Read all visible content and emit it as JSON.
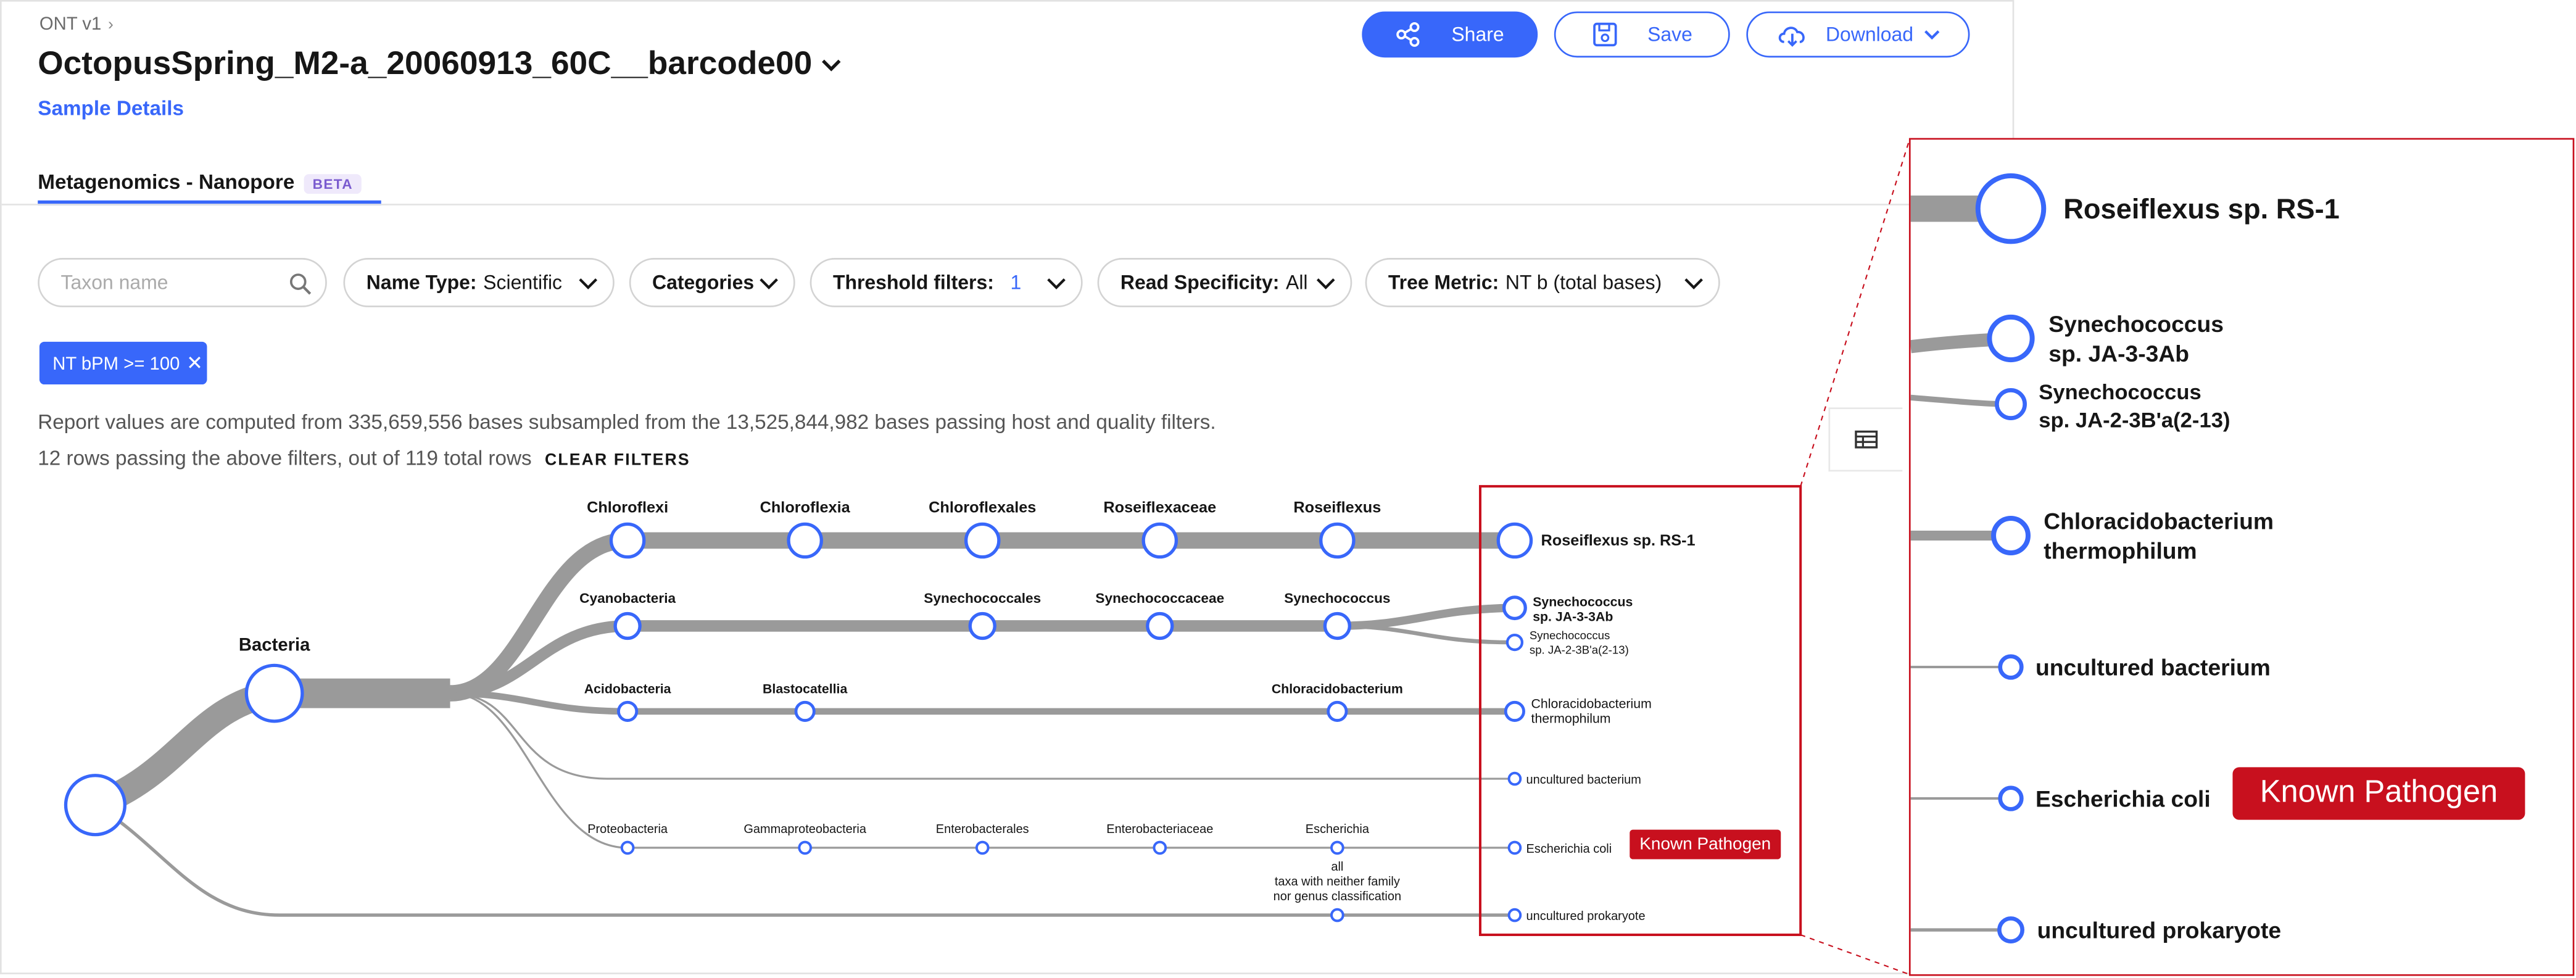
{
  "breadcrumb": {
    "project": "ONT v1",
    "separator": "›"
  },
  "sample": {
    "name": "OctopusSpring_M2-a_20060913_60C__barcode00",
    "details_link": "Sample Details"
  },
  "header_buttons": {
    "share": "Share",
    "save": "Save",
    "download": "Download"
  },
  "tab": {
    "label": "Metagenomics - Nanopore",
    "badge": "BETA"
  },
  "filters": {
    "search_placeholder": "Taxon name",
    "name_type": {
      "label": "Name Type:",
      "value": "Scientific"
    },
    "categories": {
      "label": "Categories"
    },
    "threshold": {
      "label": "Threshold filters:",
      "value": "1"
    },
    "read_specificity": {
      "label": "Read Specificity:",
      "value": "All"
    },
    "tree_metric": {
      "label": "Tree Metric:",
      "value": "NT b (total bases)"
    }
  },
  "active_filter": {
    "label": "NT bPM >= 100",
    "remove": "✕"
  },
  "report_text": "Report values are computed from 335,659,556 bases subsampled from the 13,525,844,982 bases passing host and quality filters.",
  "rows_text": "12 rows passing the above filters, out of 119 total rows",
  "clear_filters": "CLEAR FILTERS",
  "colors": {
    "accent": "#3867fa",
    "pathogen": "#c8101e",
    "branch": "#9a9a9a",
    "text": "#161616"
  },
  "tree": {
    "root_label": "",
    "kingdom": "Bacteria",
    "rows": [
      {
        "nodes": [
          "Chloroflexi",
          "Chloroflexia",
          "Chloroflexales",
          "Roseiflexaceae",
          "Roseiflexus"
        ],
        "species": [
          "Roseiflexus sp. RS-1"
        ]
      },
      {
        "nodes": [
          "Cyanobacteria",
          "Synechococcales",
          "Synechococcaceae",
          "Synechococcus"
        ],
        "species": [
          "Synechococcus sp. JA-3-3Ab",
          "Synechococcus sp. JA-2-3B'a(2-13)"
        ]
      },
      {
        "nodes": [
          "Acidobacteria",
          "Blastocatellia",
          "Chloracidobacterium"
        ],
        "species": [
          "Chloracidobacterium thermophilum"
        ]
      },
      {
        "nodes": [],
        "species": [
          "uncultured bacterium"
        ]
      },
      {
        "nodes": [
          "Proteobacteria",
          "Gammaproteobacteria",
          "Enterobacterales",
          "Enterobacteriaceae",
          "Escherichia"
        ],
        "species": [
          "Escherichia coli"
        ]
      },
      {
        "nodes": [
          "all taxa with neither family nor genus classification"
        ],
        "species": [
          "uncultured prokaryote"
        ]
      }
    ],
    "pathogen_tag": "Known Pathogen",
    "labels": {
      "chloroflexi": "Chloroflexi",
      "chloroflexia": "Chloroflexia",
      "chloroflexales": "Chloroflexales",
      "roseiflexaceae": "Roseiflexaceae",
      "roseiflexus": "Roseiflexus",
      "cyanobacteria": "Cyanobacteria",
      "synechococcales": "Synechococcales",
      "synechococcaceae": "Synechococcaceae",
      "synechococcus": "Synechococcus",
      "acidobacteria": "Acidobacteria",
      "blastocatellia": "Blastocatellia",
      "chloracidobacterium": "Chloracidobacterium",
      "proteobacteria": "Proteobacteria",
      "gammaproteobacteria": "Gammaproteobacteria",
      "enterobacterales": "Enterobacterales",
      "enterobacteriaceae": "Enterobacteriaceae",
      "escherichia": "Escherichia",
      "all_line1": "all",
      "all_line2": "taxa with neither family",
      "all_line3": "nor genus classification",
      "sp_roseiflexus": "Roseiflexus sp. RS-1",
      "sp_syn1_a": "Synechococcus",
      "sp_syn1_b": "sp. JA-3-3Ab",
      "sp_syn2_a": "Synechococcus",
      "sp_syn2_b": "sp. JA-2-3B'a(2-13)",
      "sp_chlor_a": "Chloracidobacterium",
      "sp_chlor_b": "thermophilum",
      "sp_uncult_bact": "uncultured bacterium",
      "sp_ecoli": "Escherichia coli",
      "sp_uncult_prok": "uncultured prokaryote"
    }
  }
}
